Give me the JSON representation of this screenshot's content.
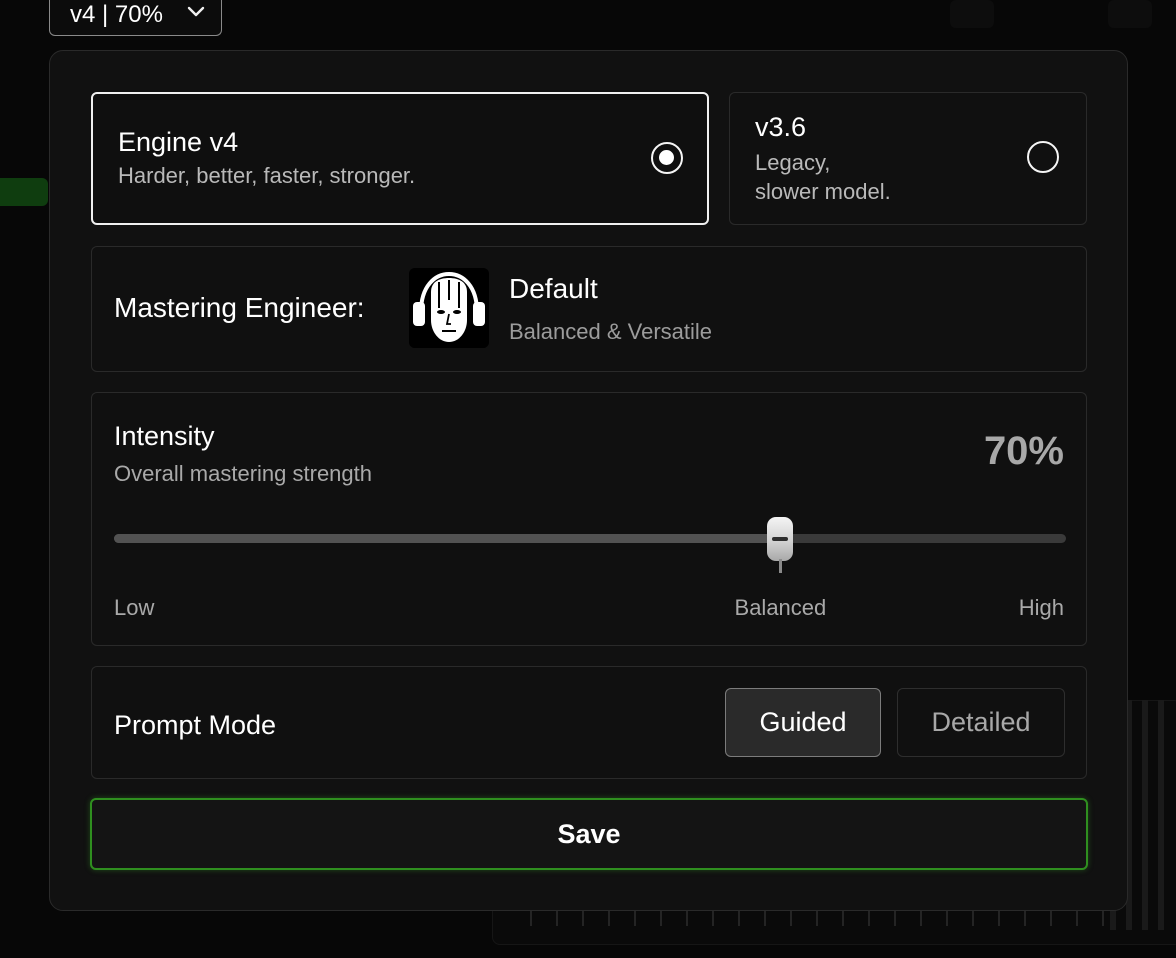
{
  "version_selector": {
    "label": "v4 | 70%"
  },
  "engines": [
    {
      "title": "Engine v4",
      "subtitle": "Harder, better, faster, stronger.",
      "selected": true
    },
    {
      "title": "v3.6",
      "subtitle_line1": "Legacy,",
      "subtitle_line2": "slower model.",
      "selected": false
    }
  ],
  "mastering_engineer": {
    "label": "Mastering Engineer:",
    "name": "Default",
    "description": "Balanced & Versatile",
    "avatar_icon": "headphones-face-icon"
  },
  "intensity": {
    "title": "Intensity",
    "subtitle": "Overall mastering strength",
    "value_label": "70%",
    "value_percent": 70,
    "low_label": "Low",
    "mid_label": "Balanced",
    "high_label": "High"
  },
  "prompt_mode": {
    "label": "Prompt Mode",
    "options": [
      "Guided",
      "Detailed"
    ],
    "selected": "Guided"
  },
  "save_label": "Save",
  "colors": {
    "accent_green": "#2f8f1f",
    "panel_bg": "#111111",
    "card_border": "#2a2a2a"
  }
}
